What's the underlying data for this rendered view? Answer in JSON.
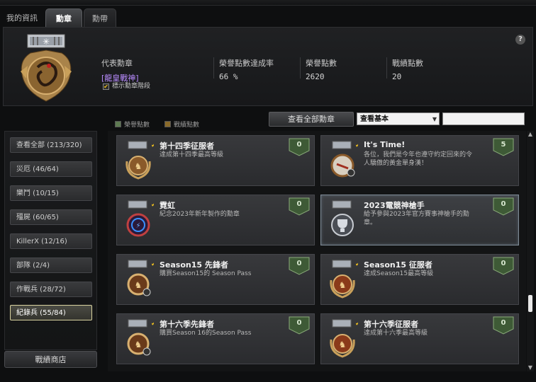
{
  "tabs": [
    {
      "label": "我的資訊"
    },
    {
      "label": "勳章"
    },
    {
      "label": "勳帶"
    }
  ],
  "header": {
    "help_label": "?",
    "representative_label": "代表勳章",
    "representative_value": "[龍皇戰神]",
    "honor_rate_label": "榮譽點數達成率",
    "honor_rate_value": "66 %",
    "honor_points_label": "榮譽點數",
    "honor_points_value": "2620",
    "battle_points_label": "戰績點數",
    "battle_points_value": "20",
    "show_rank_label": "標示勳章階段",
    "show_rank_checked": true
  },
  "filters": {
    "legend_honor": "榮譽點數",
    "legend_battle": "戰績點數",
    "legend_honor_color": "#5e7a52",
    "legend_battle_color": "#8a6a2a",
    "view_all_label": "查看全部勳章",
    "select_value": "查看基本",
    "search_value": ""
  },
  "sidebar": {
    "items": [
      {
        "label": "查看全部 (213/320)",
        "active": false
      },
      {
        "label": "災厄 (46/64)",
        "active": false
      },
      {
        "label": "樂鬥 (10/15)",
        "active": false
      },
      {
        "label": "殭屍 (60/65)",
        "active": false
      },
      {
        "label": "KillerX (12/16)",
        "active": false
      },
      {
        "label": "部隊 (2/4)",
        "active": false
      },
      {
        "label": "作戰兵 (28/72)",
        "active": false
      },
      {
        "label": "紀錄兵 (55/84)",
        "active": true
      }
    ],
    "shop_label": "戰績商店"
  },
  "medals": [
    {
      "title": "第十四季征服者",
      "desc": "達成第十四季最高等級",
      "points": "0",
      "icon": "laurel-medal-icon"
    },
    {
      "title": "It's Time!",
      "desc": "各位，我們是今年也遵守約定回來的令人驕傲的黃金單身漢！",
      "points": "5",
      "icon": "watch-medal-icon"
    },
    {
      "title": "霓虹",
      "desc": "紀念2023年新年製作的勳章",
      "points": "0",
      "icon": "neon-medal-icon"
    },
    {
      "title": "2023電競神槍手",
      "desc": "給予參與2023年官方賽事神槍手的勳章。",
      "points": "0",
      "icon": "trophy-medal-icon"
    },
    {
      "title": "Season15 先鋒者",
      "desc": "購買Season15的 Season Pass",
      "points": "0",
      "icon": "pioneer-medal-icon"
    },
    {
      "title": "Season15 征服者",
      "desc": "達成Season15最高等級",
      "points": "0",
      "icon": "laurel-medal-icon"
    },
    {
      "title": "第十六季先鋒者",
      "desc": "購買Season 16的Season Pass",
      "points": "0",
      "icon": "pioneer-medal-icon"
    },
    {
      "title": "第十六季征服者",
      "desc": "達成第十六季最高等級",
      "points": "0",
      "icon": "laurel-medal-icon"
    }
  ]
}
